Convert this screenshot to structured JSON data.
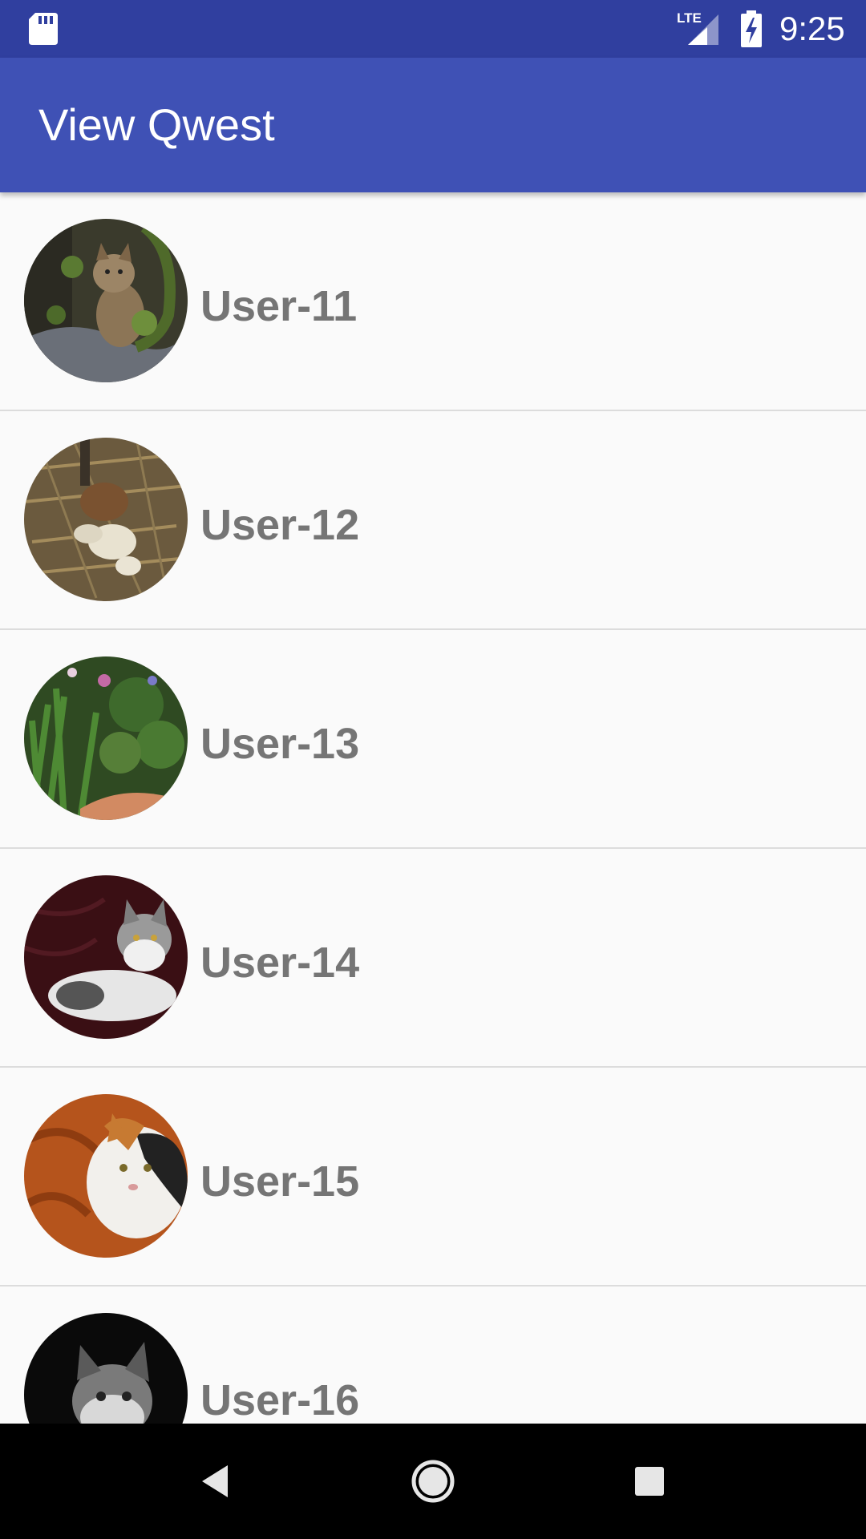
{
  "status_bar": {
    "time": "9:25",
    "network_label": "LTE",
    "icons": [
      "sd-card-icon",
      "lte-signal-icon",
      "battery-charging-icon"
    ]
  },
  "app_bar": {
    "title": "View Qwest",
    "color": "#3f51b5",
    "status_color": "#303f9f"
  },
  "users": [
    {
      "name": "User-11",
      "avatar": "wildcat-photo"
    },
    {
      "name": "User-12",
      "avatar": "kitten-in-straw-photo"
    },
    {
      "name": "User-13",
      "avatar": "garden-plants-photo"
    },
    {
      "name": "User-14",
      "avatar": "maine-coon-cat-photo"
    },
    {
      "name": "User-15",
      "avatar": "calico-cat-photo"
    },
    {
      "name": "User-16",
      "avatar": "black-white-cat-photo"
    }
  ],
  "nav_bar": {
    "icons": [
      "back-icon",
      "home-icon",
      "recents-icon"
    ]
  }
}
